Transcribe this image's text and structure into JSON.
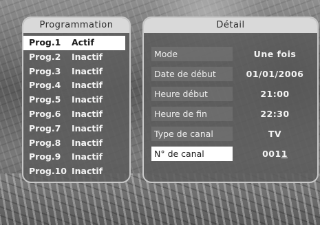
{
  "program_panel": {
    "title": "Programmation",
    "items": [
      {
        "name": "Prog.1",
        "status": "Actif"
      },
      {
        "name": "Prog.2",
        "status": "Inactif"
      },
      {
        "name": "Prog.3",
        "status": "Inactif"
      },
      {
        "name": "Prog.4",
        "status": "Inactif"
      },
      {
        "name": "Prog.5",
        "status": "Inactif"
      },
      {
        "name": "Prog.6",
        "status": "Inactif"
      },
      {
        "name": "Prog.7",
        "status": "Inactif"
      },
      {
        "name": "Prog.8",
        "status": "Inactif"
      },
      {
        "name": "Prog.9",
        "status": "Inactif"
      },
      {
        "name": "Prog.10",
        "status": "Inactif"
      }
    ],
    "selected_index": 0
  },
  "detail_panel": {
    "title": "Détail",
    "fields": [
      {
        "label": "Mode",
        "value": "Une fois"
      },
      {
        "label": "Date de début",
        "value": "01/01/2006"
      },
      {
        "label": "Heure début",
        "value": "21:00"
      },
      {
        "label": "Heure de fin",
        "value": "22:30"
      },
      {
        "label": "Type de canal",
        "value": "TV"
      },
      {
        "label": "N° de canal",
        "value_prefix": "001",
        "value_cursor": "1"
      }
    ],
    "active_index": 5
  },
  "colors": {
    "panel_bg": "#5c5c5c",
    "panel_border": "#c9c9c9",
    "title_bg": "#d9d9d9",
    "highlight": "#ffffff"
  }
}
